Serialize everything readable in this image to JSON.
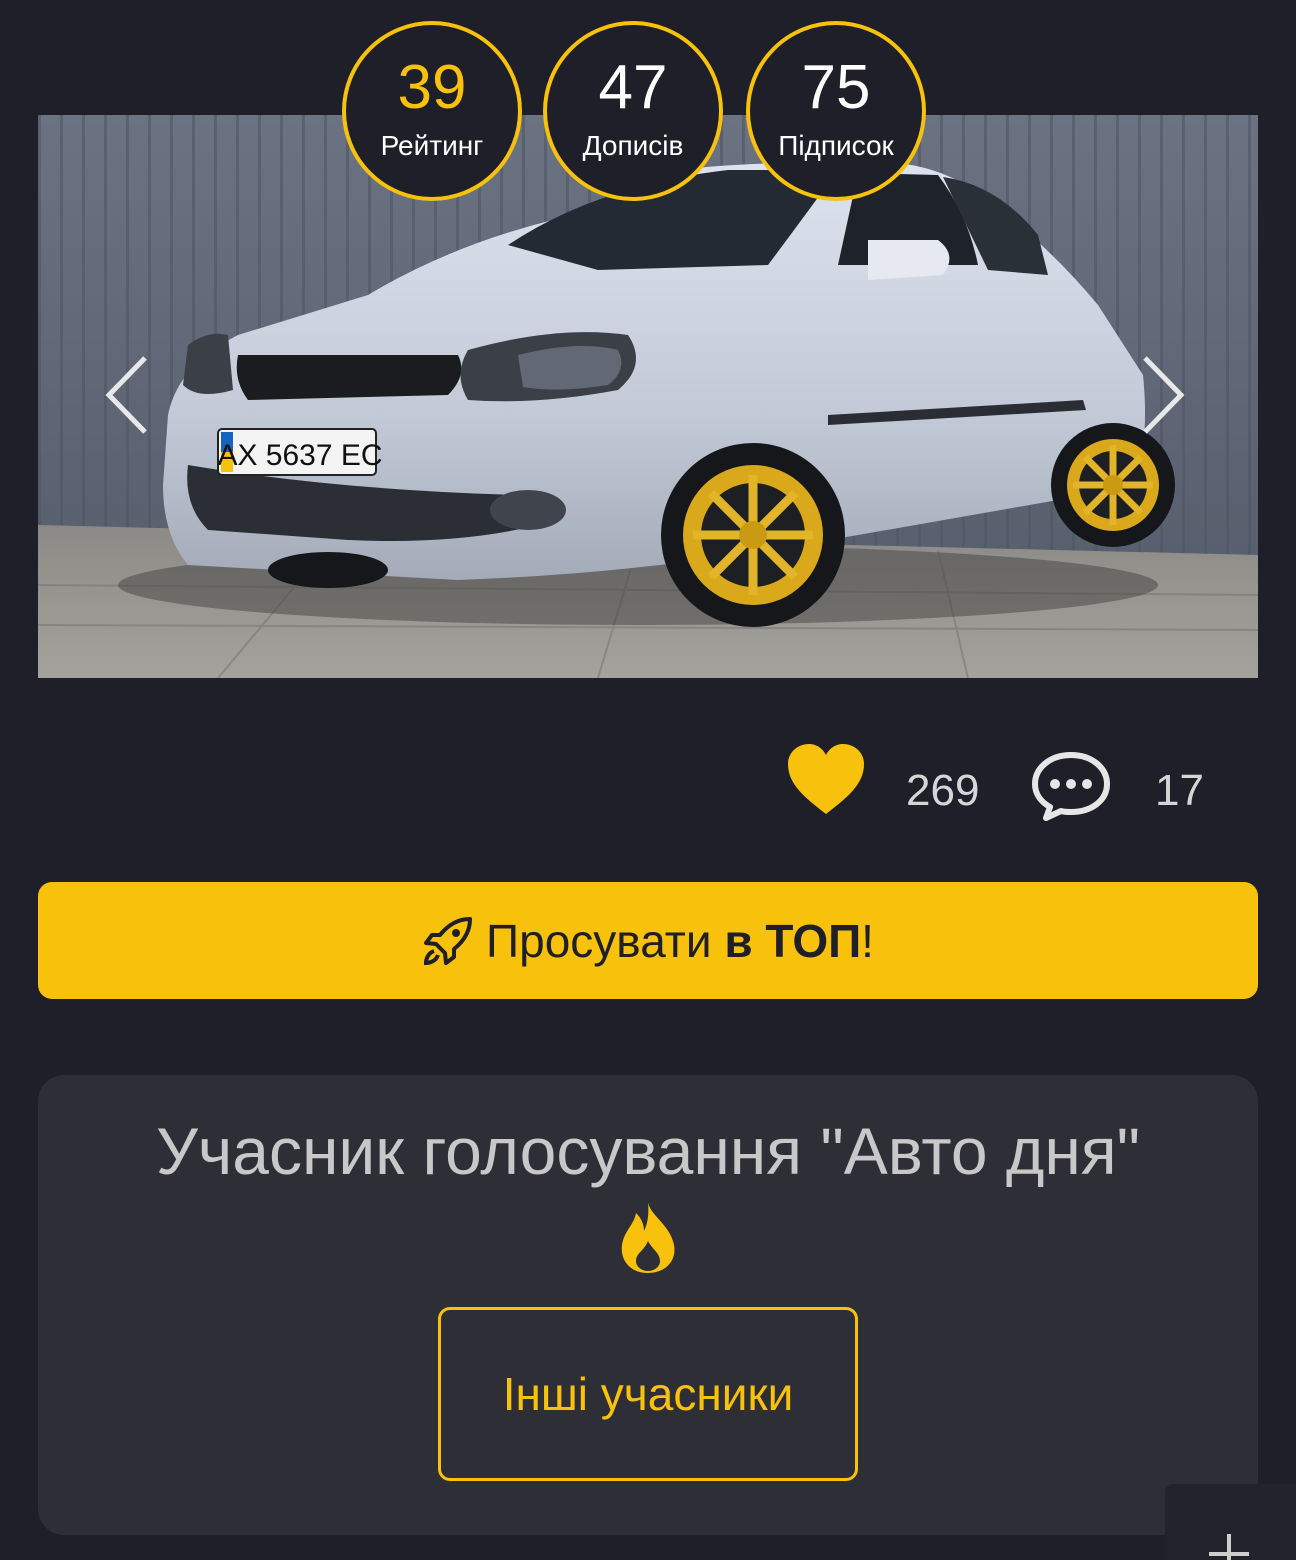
{
  "stats": [
    {
      "value": "39",
      "label": "Рейтинг",
      "color": "#f7c10c"
    },
    {
      "value": "47",
      "label": "Дописів",
      "color": "#ffffff"
    },
    {
      "value": "75",
      "label": "Підписок",
      "color": "#ffffff"
    }
  ],
  "photo": {
    "plate": "AX 5637 EC"
  },
  "reactions": {
    "likes": "269",
    "comments": "17",
    "like_icon": "heart-icon",
    "comment_icon": "comment-bubble-icon"
  },
  "promote": {
    "text_regular": "Просувати ",
    "text_bold": "в ТОП",
    "text_end": "!",
    "icon": "rocket-icon"
  },
  "voting": {
    "title": "Учасник голосування \"Авто дня\"",
    "icon": "fire-icon",
    "others_button": "Інші учасники"
  },
  "colors": {
    "accent": "#f7c10c",
    "background": "#1f1f29",
    "card": "#2e2e37"
  }
}
